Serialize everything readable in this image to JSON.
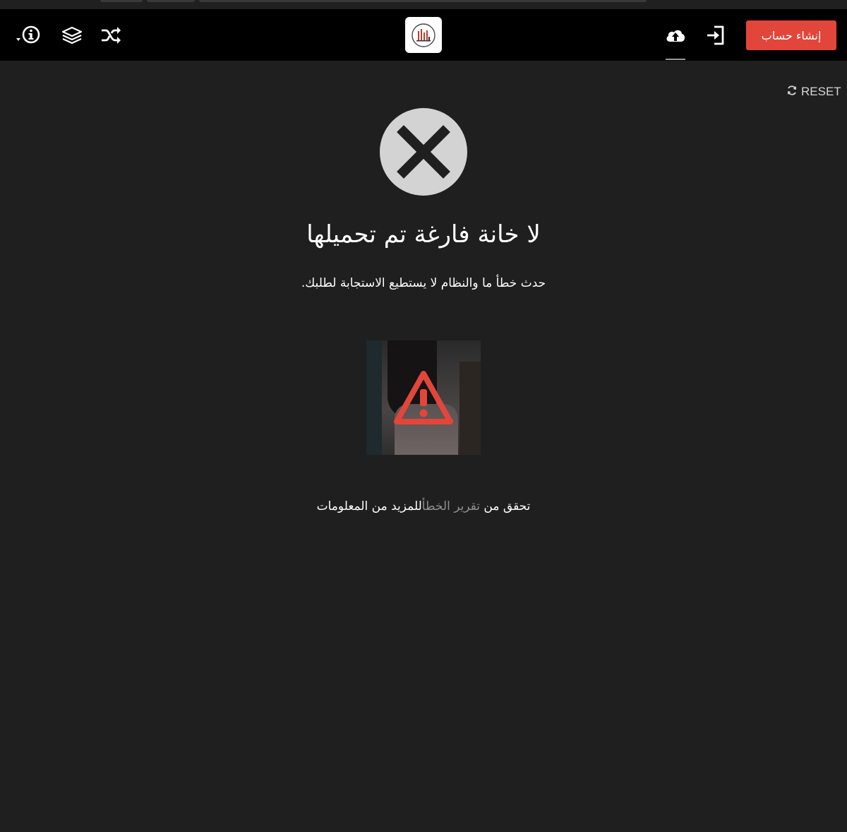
{
  "colors": {
    "page_background": "#1f1f1f",
    "topbar_background": "#000000",
    "signup_button": "#e2463b",
    "error_circle": "#d3d3d3",
    "warning_icon": "#e2463b",
    "link": "#8f8f8f"
  },
  "header": {
    "icons": [
      "info-icon",
      "layers-icon",
      "shuffle-icon",
      "logo",
      "cloud-upload-icon",
      "sign-in-icon"
    ],
    "signup_label": "إنشاء حساب"
  },
  "toolbar": {
    "reset_label": "RESET",
    "reset_icon": "refresh-icon"
  },
  "error": {
    "icon": "x-circle-icon",
    "title": "لا خانة فارغة تم تحميلها",
    "message": "حدث خطأ ما والنظام لا يستطيع الاستجابة لطلبك.",
    "thumbnail_icon": "warning-triangle-icon",
    "more_info_prefix": "تحقق من ",
    "more_info_link": "تقرير الخطأ",
    "more_info_suffix": "للمزيد من المعلومات"
  }
}
